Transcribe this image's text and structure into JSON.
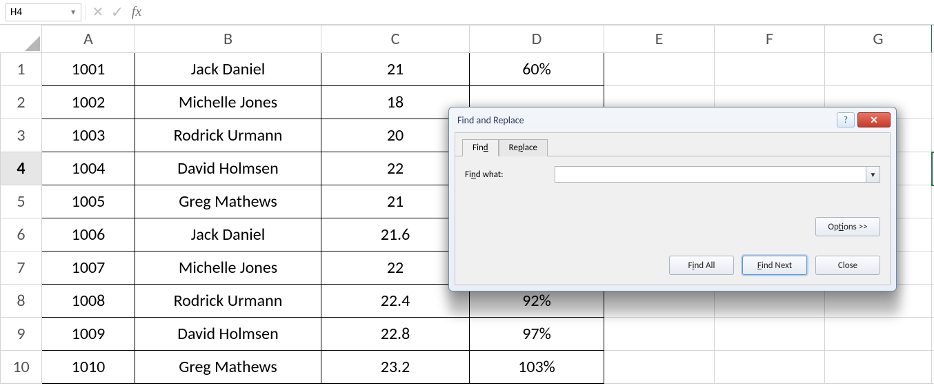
{
  "formula_bar": {
    "cell_ref": "H4",
    "fx_label": "fx",
    "formula_value": ""
  },
  "columns": [
    "A",
    "B",
    "C",
    "D",
    "E",
    "F",
    "G"
  ],
  "row_headers": [
    "1",
    "2",
    "3",
    "4",
    "5",
    "6",
    "7",
    "8",
    "9",
    "10"
  ],
  "active_row_index": 3,
  "data_rows": [
    {
      "A": "1001",
      "B": "Jack Daniel",
      "C": "21",
      "D": "60%"
    },
    {
      "A": "1002",
      "B": "Michelle Jones",
      "C": "18",
      "D": ""
    },
    {
      "A": "1003",
      "B": "Rodrick Urmann",
      "C": "20",
      "D": ""
    },
    {
      "A": "1004",
      "B": "David Holmsen",
      "C": "22",
      "D": ""
    },
    {
      "A": "1005",
      "B": "Greg Mathews",
      "C": "21",
      "D": ""
    },
    {
      "A": "1006",
      "B": "Jack Daniel",
      "C": "21.6",
      "D": ""
    },
    {
      "A": "1007",
      "B": "Michelle Jones",
      "C": "22",
      "D": ""
    },
    {
      "A": "1008",
      "B": "Rodrick Urmann",
      "C": "22.4",
      "D": "92%"
    },
    {
      "A": "1009",
      "B": "David Holmsen",
      "C": "22.8",
      "D": "97%"
    },
    {
      "A": "1010",
      "B": "Greg Mathews",
      "C": "23.2",
      "D": "103%"
    }
  ],
  "dialog": {
    "title": "Find and Replace",
    "tab_find": "Find",
    "tab_replace": "Replace",
    "find_what_label": "Find what:",
    "find_what_value": "",
    "options_label": "Options >>",
    "find_all_label": "Find All",
    "find_next_label": "Find Next",
    "close_label": "Close",
    "help_label": "?",
    "close_x": "✕"
  }
}
